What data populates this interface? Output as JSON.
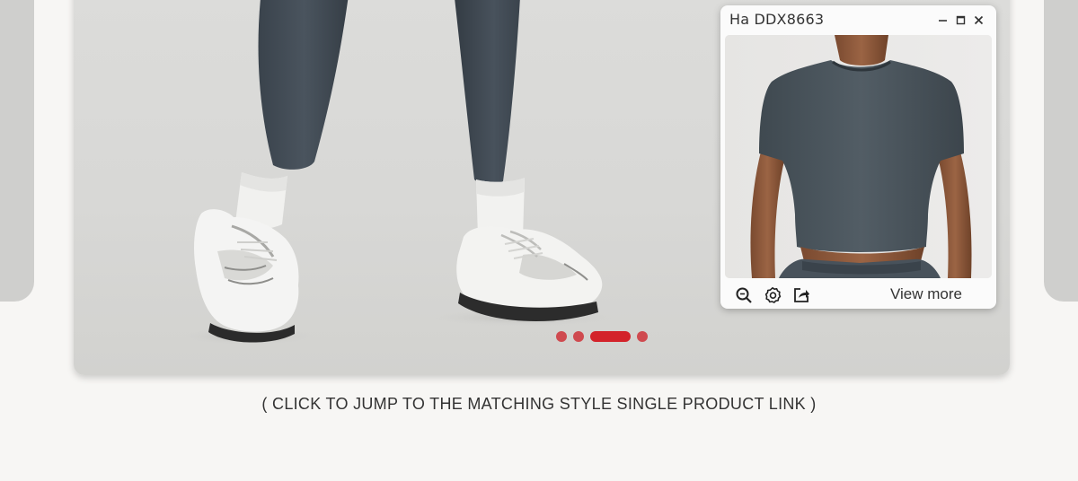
{
  "popup": {
    "title": "Ha DDX8663",
    "view_more_label": "View more",
    "tools": [
      "zoom-icon",
      "settings-icon",
      "share-icon"
    ],
    "window_controls": [
      "minimize-icon",
      "maximize-icon",
      "close-icon"
    ]
  },
  "carousel": {
    "slide_count": 4,
    "active_index": 2,
    "dot_color": "#cf4a4f",
    "active_dot_color": "#d3232a"
  },
  "caption": "( CLICK TO JUMP TO THE MATCHING STYLE SINGLE PRODUCT LINK )"
}
